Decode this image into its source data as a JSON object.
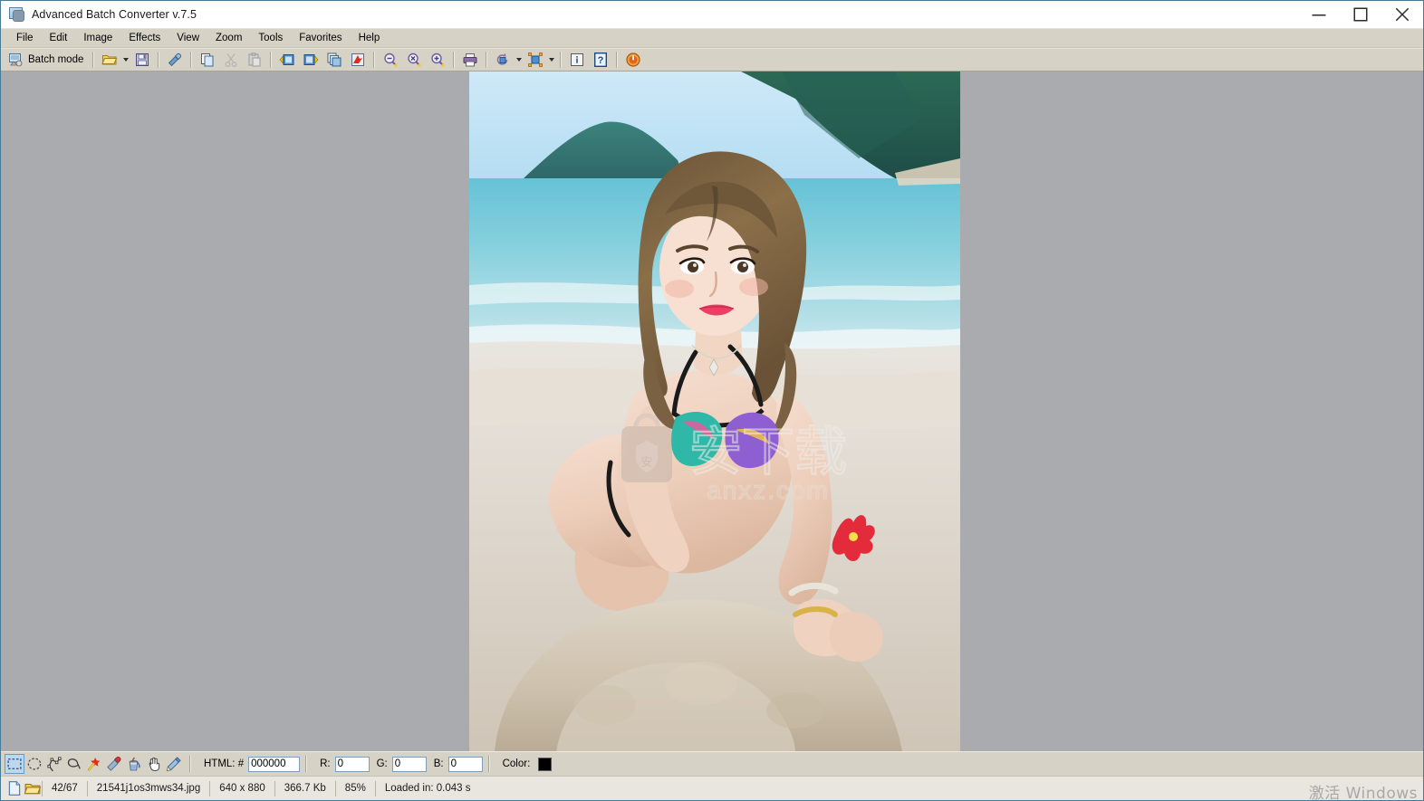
{
  "window": {
    "title": "Advanced Batch Converter v.7.5",
    "app_icon": "batch-converter-icon",
    "controls": {
      "minimize": "minimize-icon",
      "maximize": "maximize-icon",
      "close": "close-icon"
    }
  },
  "menubar": {
    "items": [
      {
        "label": "File"
      },
      {
        "label": "Edit"
      },
      {
        "label": "Image"
      },
      {
        "label": "Effects"
      },
      {
        "label": "View"
      },
      {
        "label": "Zoom"
      },
      {
        "label": "Tools"
      },
      {
        "label": "Favorites"
      },
      {
        "label": "Help"
      }
    ]
  },
  "toolbar": {
    "batch_mode_label": "Batch mode",
    "items": [
      {
        "name": "batch-mode-icon",
        "label": "Batch mode"
      },
      {
        "name": "open-folder-icon",
        "label": "Open"
      },
      {
        "name": "open-dropdown-arrow",
        "label": "Open recent"
      },
      {
        "name": "save-icon",
        "label": "Save"
      },
      {
        "name": "color-picker-icon",
        "label": "Color picker"
      },
      {
        "name": "copy-icon",
        "label": "Copy"
      },
      {
        "name": "cut-icon",
        "label": "Cut"
      },
      {
        "name": "paste-icon",
        "label": "Paste"
      },
      {
        "name": "previous-image-icon",
        "label": "Previous image"
      },
      {
        "name": "next-image-icon",
        "label": "Next image"
      },
      {
        "name": "duplicate-icon",
        "label": "Duplicate"
      },
      {
        "name": "refresh-icon",
        "label": "Refresh"
      },
      {
        "name": "zoom-out-icon",
        "label": "Zoom out"
      },
      {
        "name": "zoom-actual-icon",
        "label": "Actual size"
      },
      {
        "name": "zoom-in-icon",
        "label": "Zoom in"
      },
      {
        "name": "print-icon",
        "label": "Print"
      },
      {
        "name": "rotate-icon",
        "label": "Rotate"
      },
      {
        "name": "rotate-dropdown-arrow",
        "label": "Rotate options"
      },
      {
        "name": "resize-icon",
        "label": "Resize"
      },
      {
        "name": "resize-dropdown-arrow",
        "label": "Resize options"
      },
      {
        "name": "info-icon",
        "label": "Image information"
      },
      {
        "name": "help-icon",
        "label": "Help"
      },
      {
        "name": "exit-icon",
        "label": "Exit"
      }
    ]
  },
  "canvas": {
    "background_color": "#a9abae",
    "image": {
      "display_width": 542,
      "display_height": 752,
      "watermark_text": "安下载",
      "watermark_url": "anxz.com",
      "alt": "Woman in bikini kneeling on a tropical beach with turquoise sea and green headland behind"
    }
  },
  "colorbar": {
    "tools": [
      {
        "name": "rectangle-select-tool",
        "label": "Rectangular selection",
        "active": true
      },
      {
        "name": "ellipse-select-tool",
        "label": "Elliptical selection",
        "active": false
      },
      {
        "name": "polygon-select-tool",
        "label": "Polygonal selection",
        "active": false
      },
      {
        "name": "lasso-select-tool",
        "label": "Lasso selection",
        "active": false
      },
      {
        "name": "magic-wand-tool",
        "label": "Magic wand",
        "active": false
      },
      {
        "name": "eyedropper-tool",
        "label": "Eyedropper",
        "active": false
      },
      {
        "name": "paint-bucket-tool",
        "label": "Paint bucket",
        "active": false
      },
      {
        "name": "hand-tool",
        "label": "Hand",
        "active": false
      },
      {
        "name": "pencil-tool",
        "label": "Pencil",
        "active": false
      }
    ],
    "html_label": "HTML: #",
    "html_value": "000000",
    "r_label": "R:",
    "r_value": "0",
    "g_label": "G:",
    "g_value": "0",
    "b_label": "B:",
    "b_value": "0",
    "color_label": "Color:",
    "color_swatch": "#000000"
  },
  "statusbar": {
    "file_icon": "new-file-icon",
    "folder_icon": "open-folder-icon",
    "position": "42/67",
    "filename": "21541j1os3mws34.jpg",
    "dimensions": "640 x 880",
    "filesize": "366.7 Kb",
    "zoom": "85%",
    "load_time": "Loaded in: 0.043 s"
  },
  "os_watermark": {
    "text": "激活 Windows"
  }
}
